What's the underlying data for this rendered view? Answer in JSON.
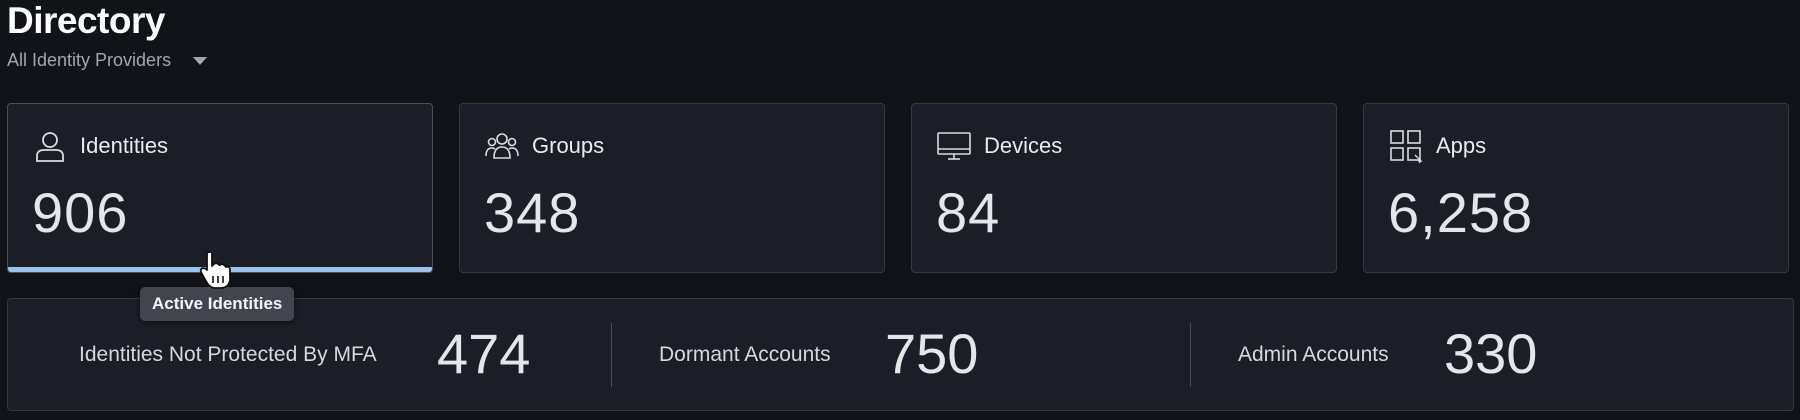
{
  "header": {
    "title": "Directory",
    "filter_label": "All Identity Providers"
  },
  "cards": [
    {
      "label": "Identities",
      "value": "906",
      "icon": "user-icon"
    },
    {
      "label": "Groups",
      "value": "348",
      "icon": "users-group-icon"
    },
    {
      "label": "Devices",
      "value": "84",
      "icon": "monitor-icon"
    },
    {
      "label": "Apps",
      "value": "6,258",
      "icon": "apps-grid-icon"
    }
  ],
  "summary": [
    {
      "label": "Identities Not Protected By MFA",
      "value": "474"
    },
    {
      "label": "Dormant Accounts",
      "value": "750"
    },
    {
      "label": "Admin Accounts",
      "value": "330"
    }
  ],
  "tooltip": "Active Identities",
  "colors": {
    "background": "#111318",
    "card": "#1b1e26",
    "accent_bar": "#9cc3ea"
  }
}
